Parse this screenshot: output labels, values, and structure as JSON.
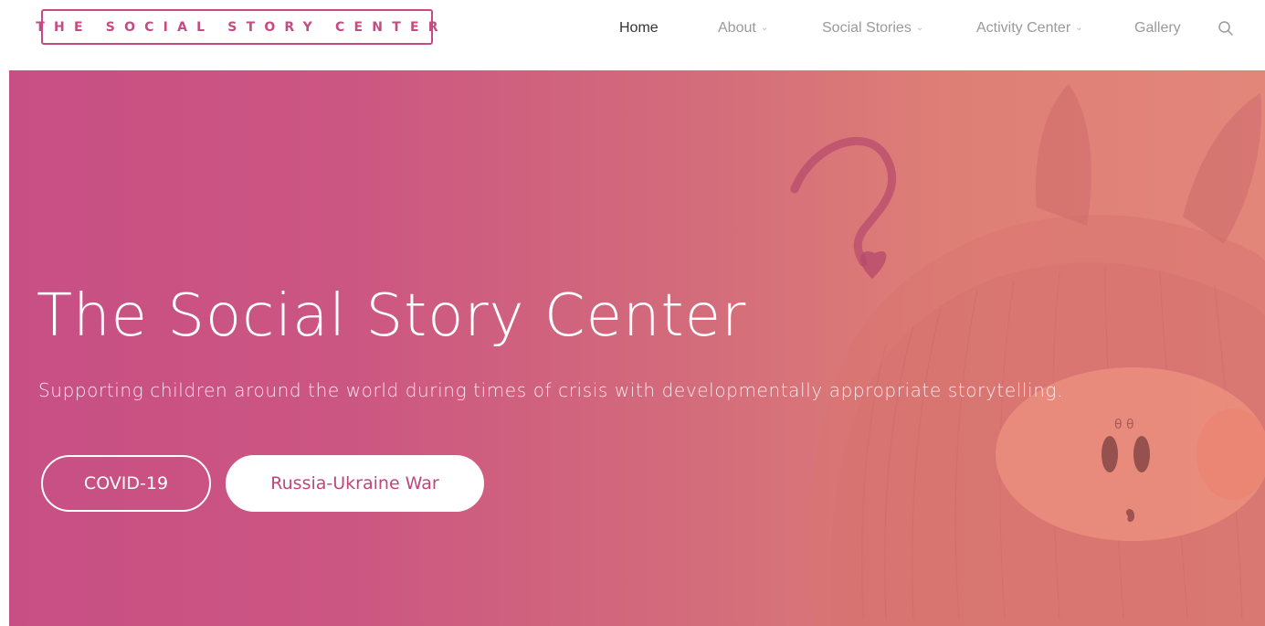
{
  "brand": {
    "logo_text": "THE SOCIAL STORY CENTER",
    "accent_color": "#c54c82"
  },
  "nav": {
    "items": [
      {
        "label": "Home",
        "active": true,
        "has_dropdown": false
      },
      {
        "label": "About",
        "active": false,
        "has_dropdown": true
      },
      {
        "label": "Social Stories",
        "active": false,
        "has_dropdown": true
      },
      {
        "label": "Activity Center",
        "active": false,
        "has_dropdown": true
      },
      {
        "label": "Gallery",
        "active": false,
        "has_dropdown": false
      }
    ],
    "search_icon": "search-icon",
    "dropdown_icon": "chevron-down-icon"
  },
  "hero": {
    "title": "The Social Story Center",
    "subtitle": "Supporting children around the world during times of crisis with developmentally appropriate storytelling.",
    "buttons": [
      {
        "label": "COVID-19",
        "style": "outline"
      },
      {
        "label": "Russia-Ukraine War",
        "style": "solid"
      }
    ],
    "gradient_colors": [
      "#c74f84",
      "#d36c7b",
      "#e3867a"
    ]
  }
}
